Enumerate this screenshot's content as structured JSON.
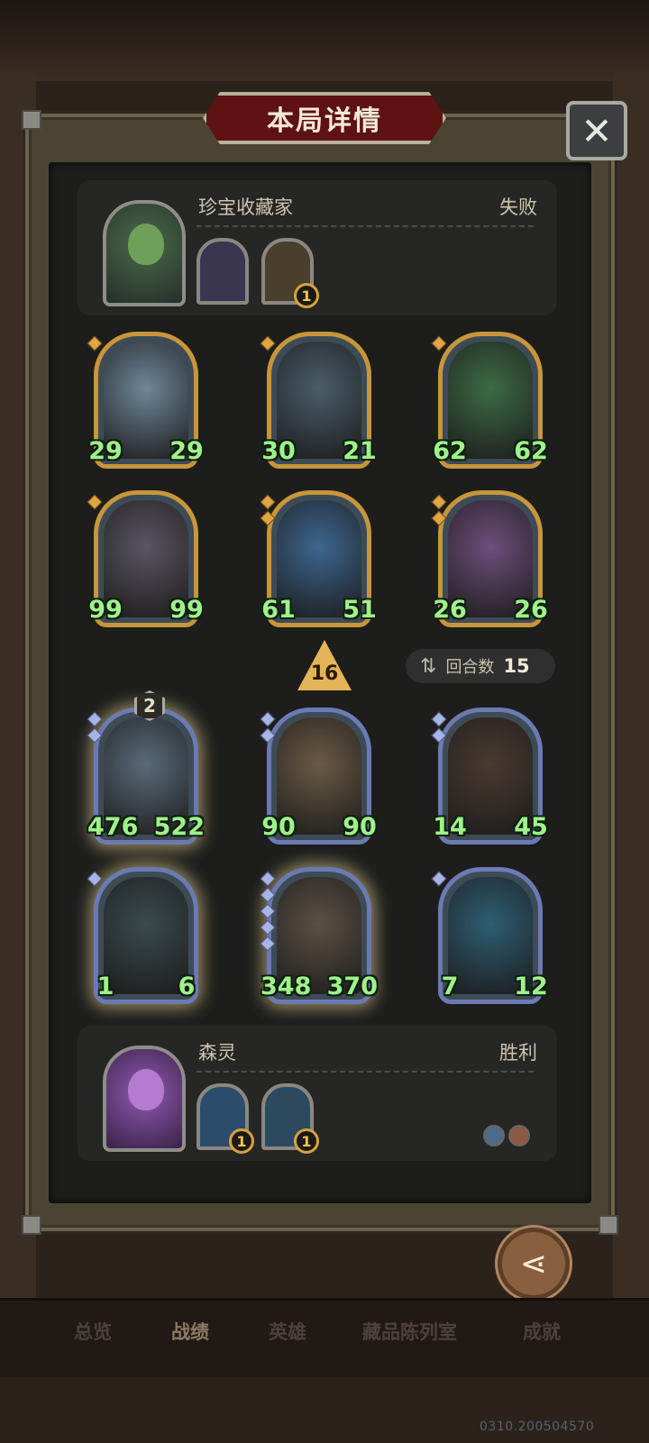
{
  "title": "本局详情",
  "close_glyph": "✕",
  "opponent": {
    "name": "珍宝收藏家",
    "result": "失败",
    "trinkets": [
      {
        "badge": ""
      },
      {
        "badge": "1"
      }
    ]
  },
  "opponent_board": [
    {
      "atk": "29",
      "hp": "29",
      "border": "gold",
      "tiers": 1,
      "art": "#6f8799"
    },
    {
      "atk": "30",
      "hp": "21",
      "border": "gold",
      "tiers": 1,
      "art": "#4a5d6a"
    },
    {
      "atk": "62",
      "hp": "62",
      "border": "gold",
      "tiers": 1,
      "art": "#3d6b44"
    },
    {
      "atk": "99",
      "hp": "99",
      "border": "gold",
      "tiers": 1,
      "art": "#5b5462"
    },
    {
      "atk": "61",
      "hp": "51",
      "border": "gold",
      "tiers": 2,
      "art": "#3d6690"
    },
    {
      "atk": "26",
      "hp": "26",
      "border": "gold",
      "tiers": 2,
      "art": "#6e4e7c"
    }
  ],
  "tier_indicator": "16",
  "round": {
    "label": "回合数",
    "value": "15"
  },
  "player_board": [
    {
      "atk": "476",
      "hp": "522",
      "border": "silver",
      "tiers": 2,
      "art": "#5a6b7a",
      "level": "2",
      "glow": true
    },
    {
      "atk": "90",
      "hp": "90",
      "border": "silver",
      "tiers": 2,
      "art": "#6b5a44"
    },
    {
      "atk": "14",
      "hp": "45",
      "border": "silver",
      "tiers": 2,
      "art": "#4a3a30"
    },
    {
      "atk": "1",
      "hp": "6",
      "border": "silver",
      "tiers": 1,
      "art": "#3a4a4e",
      "glow": true
    },
    {
      "atk": "348",
      "hp": "370",
      "border": "silver",
      "tiers": 5,
      "art": "#5c5044",
      "glow": true
    },
    {
      "atk": "7",
      "hp": "12",
      "border": "silver",
      "tiers": 1,
      "art": "#2e5e74"
    }
  ],
  "player": {
    "name": "森灵",
    "result": "胜利",
    "trinkets": [
      {
        "badge": "1"
      },
      {
        "badge": "1"
      }
    ]
  },
  "share_label": "分享",
  "tabs": [
    "总览",
    "战绩",
    "英雄",
    "藏品陈列室",
    "成就"
  ],
  "active_tab": "战绩",
  "version": "0310.200504570"
}
